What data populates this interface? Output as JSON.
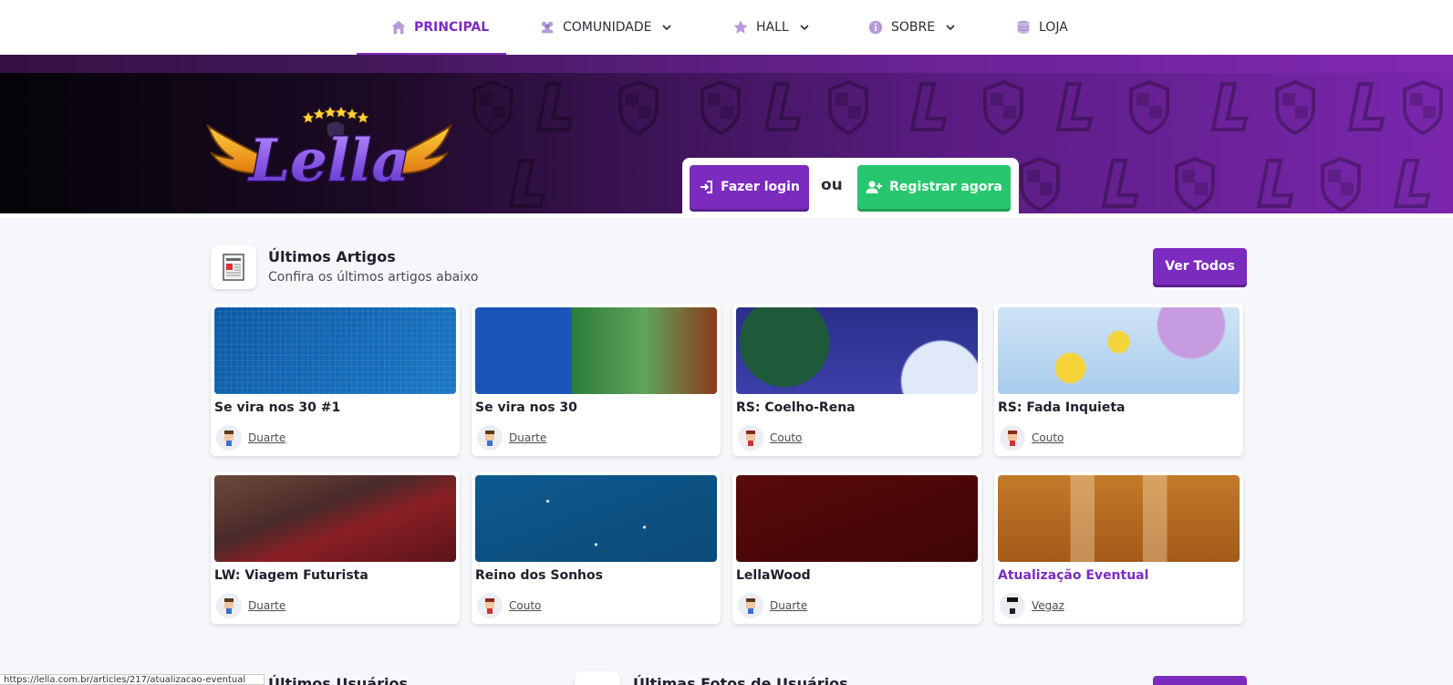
{
  "nav": {
    "items": [
      {
        "label": "PRINCIPAL",
        "icon": "home-icon"
      },
      {
        "label": "COMUNIDADE",
        "icon": "users-icon"
      },
      {
        "label": "HALL",
        "icon": "star-icon"
      },
      {
        "label": "SOBRE",
        "icon": "info-icon"
      },
      {
        "label": "LOJA",
        "icon": "coins-icon"
      }
    ]
  },
  "hero": {
    "login_label": "Fazer login",
    "or_label": "ou",
    "register_label": "Registrar agora"
  },
  "articles": {
    "title": "Últimos Artigos",
    "subtitle": "Confira os últimos artigos abaixo",
    "see_all_label": "Ver Todos",
    "items": [
      {
        "title": "Se vira nos 30 #1",
        "author": "Duarte"
      },
      {
        "title": "Se vira nos 30",
        "author": "Duarte"
      },
      {
        "title": "RS: Coelho-Rena",
        "author": "Couto"
      },
      {
        "title": "RS: Fada Inquieta",
        "author": "Couto"
      },
      {
        "title": "LW: Viagem Futurista",
        "author": "Duarte"
      },
      {
        "title": "Reino dos Sonhos",
        "author": "Couto"
      },
      {
        "title": "LellaWood",
        "author": "Duarte"
      },
      {
        "title": "Atualização Eventual",
        "author": "Vegaz"
      }
    ]
  },
  "bottom": {
    "users_title": "Últimos Usuários",
    "photos_title": "Últimas Fotos de Usuários"
  },
  "status_url": "https://lella.com.br/articles/217/atualizacao-eventual",
  "colors": {
    "brand": "#7b2cbf",
    "success": "#28c76f"
  }
}
